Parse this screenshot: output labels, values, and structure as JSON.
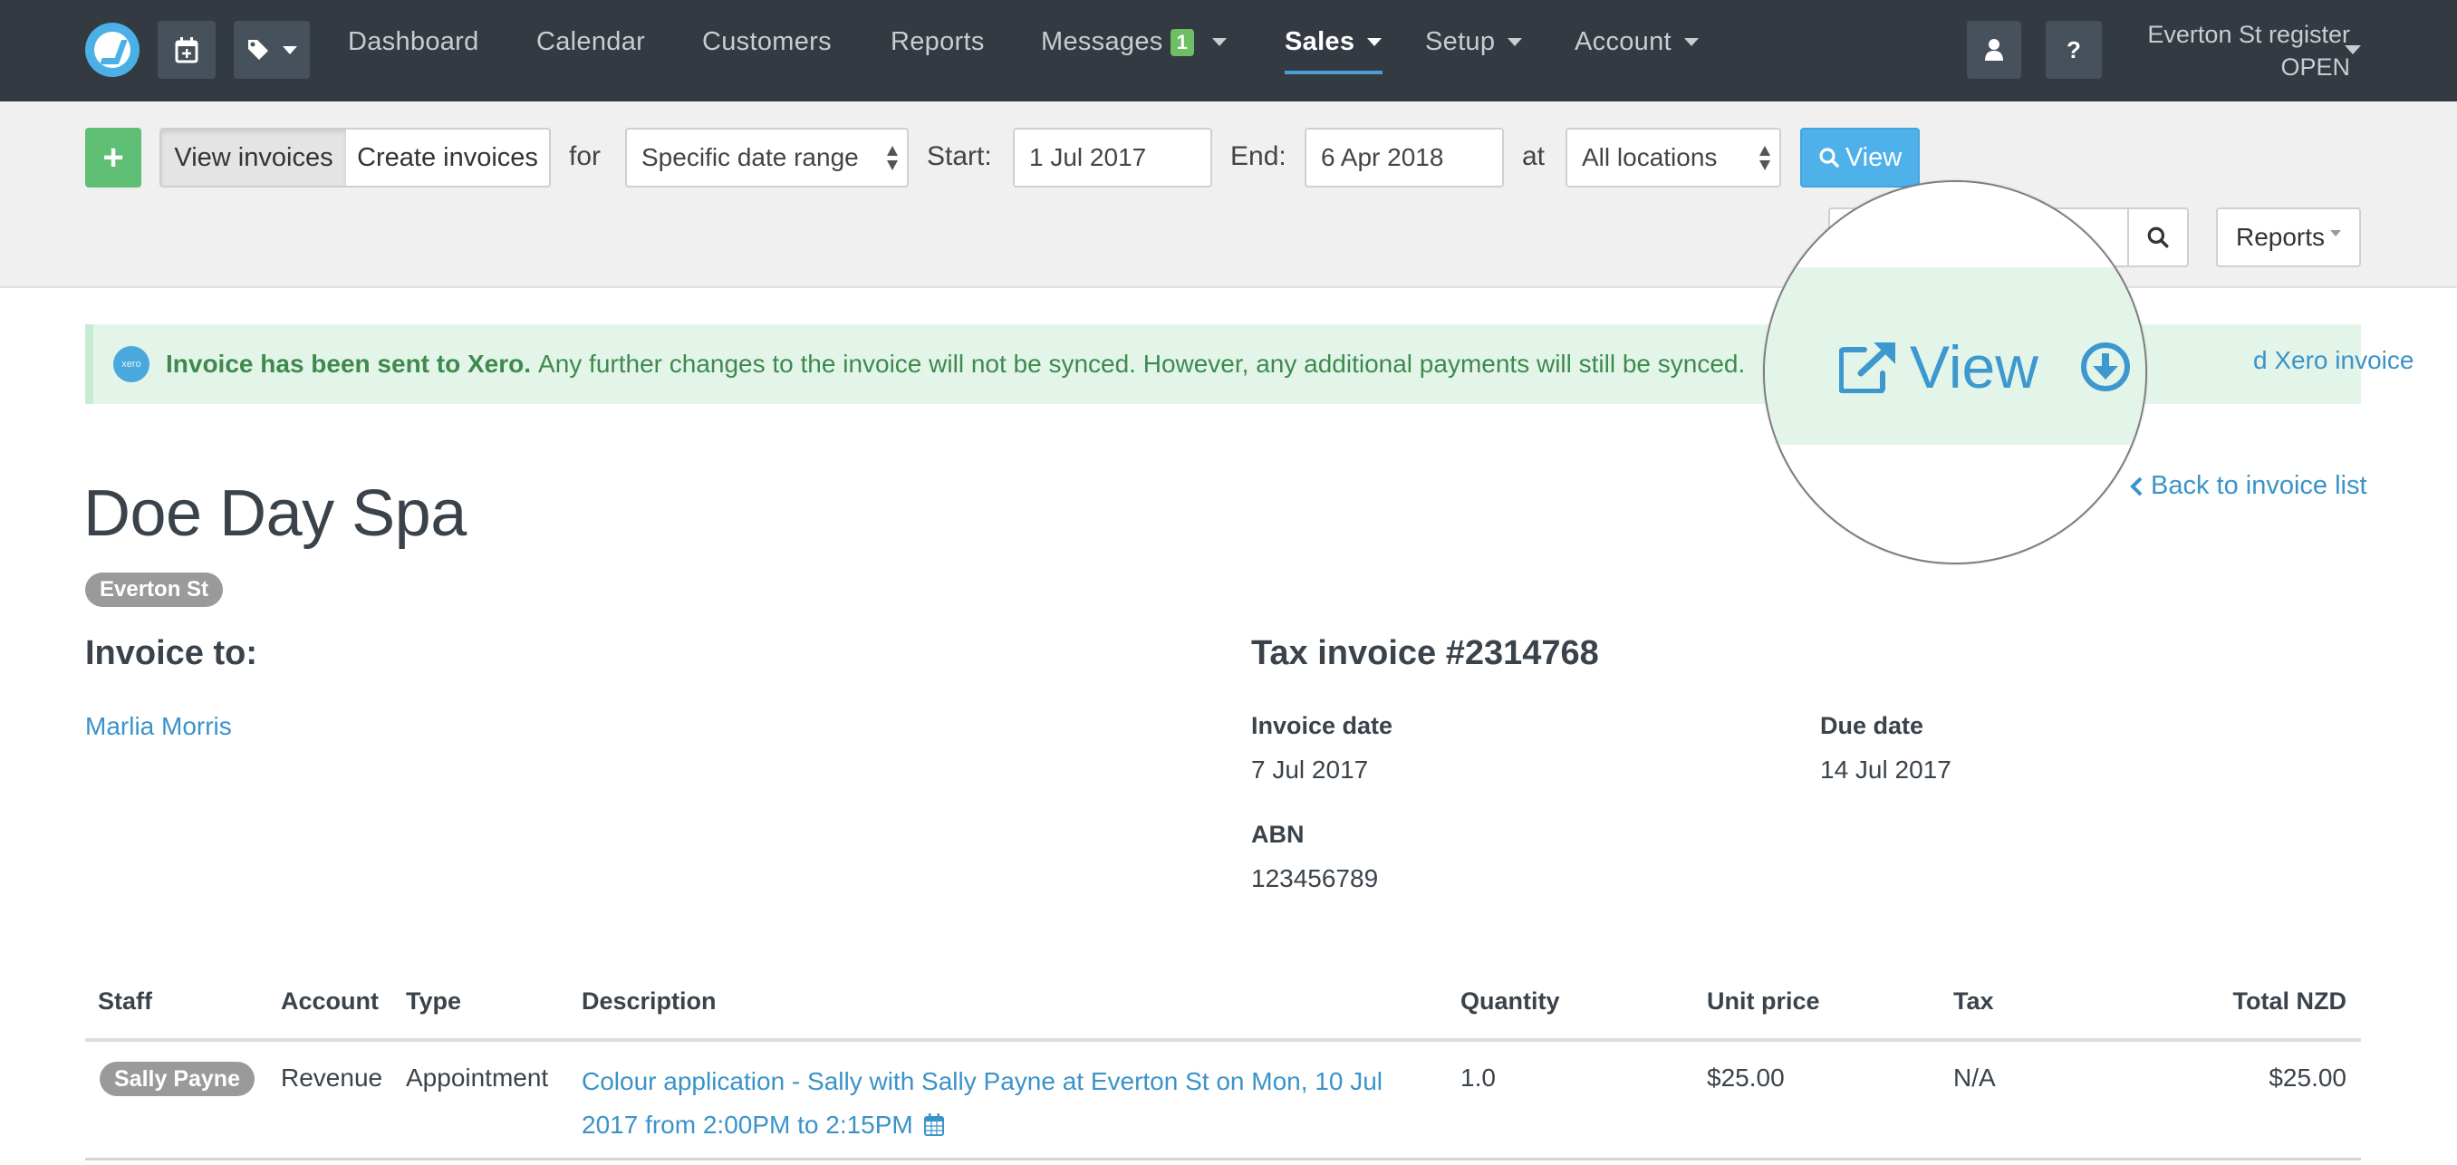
{
  "navbar": {
    "logo": "app-logo",
    "quick_buttons": [
      {
        "icon": "calendar-plus-icon"
      },
      {
        "icon": "tag-icon",
        "has_dropdown": true
      }
    ],
    "links": [
      {
        "label": "Dashboard"
      },
      {
        "label": "Calendar"
      },
      {
        "label": "Customers"
      },
      {
        "label": "Reports"
      },
      {
        "label": "Messages",
        "badge": "1",
        "has_dropdown": true
      },
      {
        "label": "Sales",
        "has_dropdown": true,
        "active": true
      },
      {
        "label": "Setup",
        "has_dropdown": true
      },
      {
        "label": "Account",
        "has_dropdown": true
      }
    ],
    "user_icon": "user-icon",
    "help_icon": "question-icon",
    "help_label": "?",
    "register": {
      "name": "Everton St register",
      "status": "OPEN"
    }
  },
  "toolbar": {
    "add_label": "+",
    "view_invoices": "View invoices",
    "create_invoices": "Create invoices",
    "for_label": "for",
    "range_select": "Specific date range",
    "start_label": "Start:",
    "start_value": "1 Jul 2017",
    "end_label": "End:",
    "end_value": "6 Apr 2018",
    "at_label": "at",
    "location_select": "All locations",
    "view_button": "View",
    "search_placeholder": "",
    "reports_button": "Reports"
  },
  "alert": {
    "icon_text": "xero",
    "bold": "Invoice has been sent to Xero.",
    "message": "Any further changes to the invoice will not be synced. However, any additional payments will still be synced.",
    "link_partial": "d Xero invoice"
  },
  "magnifier": {
    "view_label": "View"
  },
  "invoice": {
    "business_name": "Doe Day Spa",
    "location_badge": "Everton St",
    "back_link": "Back to invoice list",
    "invoice_to_heading": "Invoice to:",
    "customer": "Marlia Morris",
    "tax_heading": "Tax invoice #2314768",
    "invoice_date_label": "Invoice date",
    "invoice_date": "7 Jul 2017",
    "due_date_label": "Due date",
    "due_date": "14 Jul 2017",
    "abn_label": "ABN",
    "abn": "123456789"
  },
  "table": {
    "headers": [
      "Staff",
      "Account",
      "Type",
      "Description",
      "Quantity",
      "Unit price",
      "Tax",
      "Total NZD"
    ],
    "rows": [
      {
        "staff": "Sally Payne",
        "account": "Revenue",
        "type": "Appointment",
        "description": "Colour application - Sally with Sally Payne at Everton St on Mon, 10 Jul 2017 from 2:00PM to 2:15PM",
        "quantity": "1.0",
        "unit_price": "$25.00",
        "tax": "N/A",
        "total": "$25.00"
      }
    ]
  },
  "colors": {
    "navbar_bg": "#343a42",
    "accent_blue": "#4fb1ea",
    "link_blue": "#3a93c9",
    "success_green": "#5fbf74",
    "alert_bg": "#e3f5e9",
    "alert_text": "#3e8a4e",
    "badge_gray": "#9a9a9a"
  }
}
